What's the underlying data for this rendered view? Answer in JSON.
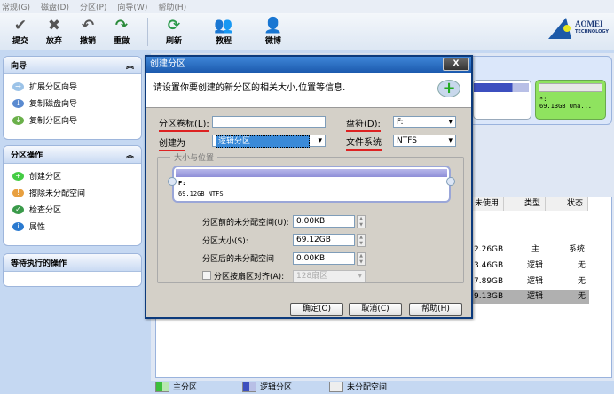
{
  "menu": [
    "常规(G)",
    "磁盘(D)",
    "分区(P)",
    "向导(W)",
    "帮助(H)"
  ],
  "toolbar": [
    {
      "label": "提交",
      "icon": "✔"
    },
    {
      "label": "放弃",
      "icon": "✖"
    },
    {
      "label": "撤销",
      "icon": "↶"
    },
    {
      "label": "重做",
      "icon": "↷"
    },
    {
      "label": "刷新",
      "icon": "⟳"
    },
    {
      "label": "教程",
      "icon": "👥"
    },
    {
      "label": "微博",
      "icon": "👤"
    }
  ],
  "logo": {
    "name": "AOMEI",
    "sub": "TECHNOLOGY"
  },
  "sidebar": {
    "wizard": {
      "title": "向导",
      "items": [
        "扩展分区向导",
        "复制磁盘向导",
        "复制分区向导"
      ]
    },
    "ops": {
      "title": "分区操作",
      "items": [
        "创建分区",
        "擦除未分配空间",
        "检查分区",
        "属性"
      ]
    },
    "pending": {
      "title": "等待执行的操作"
    }
  },
  "disk": {
    "unalloc_letter": "*:",
    "unalloc_info": "69.13GB Una..."
  },
  "table": {
    "headers": [
      "未使用",
      "类型",
      "状态"
    ],
    "rows": [
      [
        "2.26GB",
        "主",
        "系统"
      ],
      [
        "3.46GB",
        "逻辑",
        "无"
      ],
      [
        "7.89GB",
        "逻辑",
        "无"
      ],
      [
        "9.13GB",
        "逻辑",
        "无"
      ]
    ]
  },
  "legend": [
    "主分区",
    "逻辑分区",
    "未分配空间"
  ],
  "colors": {
    "primary": "#3cbf3c",
    "logical": "#3c4fbf",
    "unalloc": "#eeeeee"
  },
  "dialog": {
    "title": "创建分区",
    "close": "X",
    "description": "请设置你要创建的新分区的相关大小,位置等信息.",
    "label_volume": "分区卷标(L):",
    "volume_value": "",
    "label_create_as": "创建为",
    "create_as_value": "逻辑分区",
    "label_letter": "盘符(D):",
    "letter_value": "F:",
    "label_fs": "文件系统",
    "fs_value": "NTFS",
    "group_title": "大小与位置",
    "slider_letter": "F:",
    "slider_info": "69.12GB NTFS",
    "label_before": "分区前的未分配空间(U):",
    "before_value": "0.00KB",
    "label_size": "分区大小(S):",
    "size_value": "69.12GB",
    "label_after": "分区后的未分配空间",
    "after_value": "0.00KB",
    "label_align": "分区按扇区对齐(A):",
    "align_value": "128扇区",
    "ok": "确定(O)",
    "cancel": "取消(C)",
    "help": "帮助(H)"
  }
}
